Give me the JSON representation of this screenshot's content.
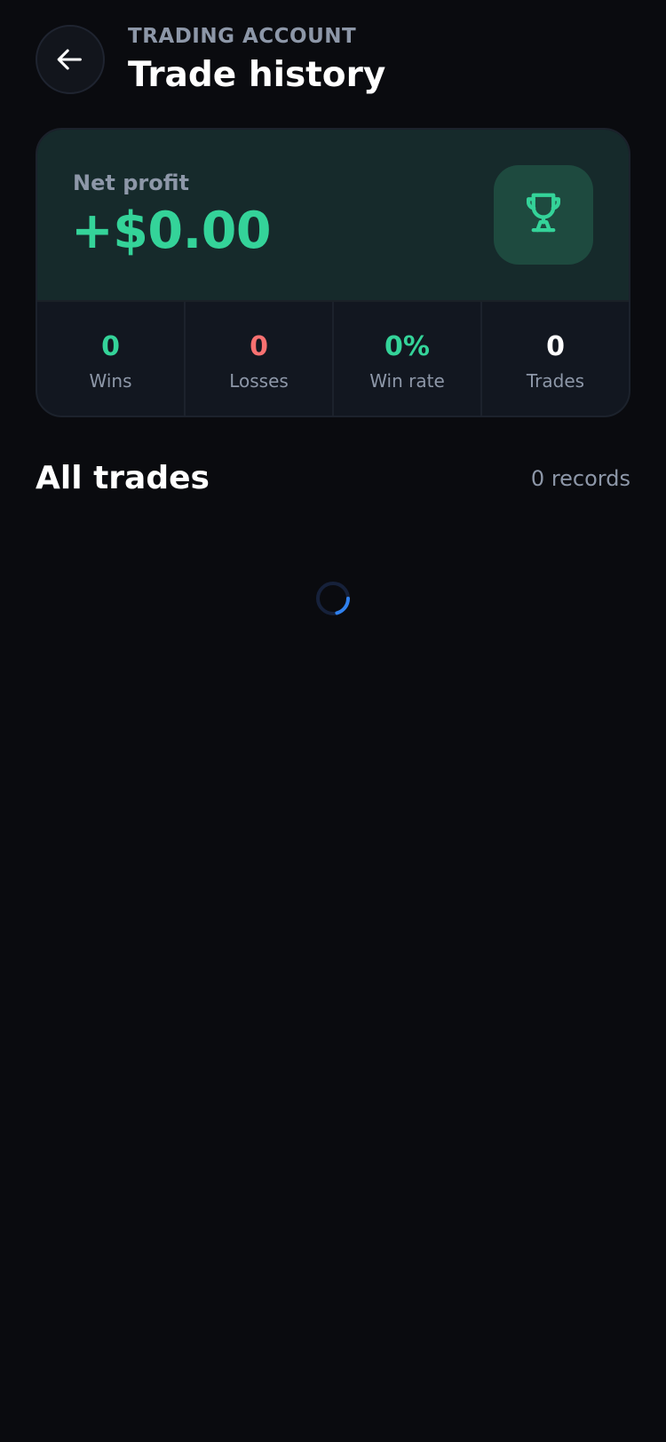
{
  "header": {
    "back_icon": "arrow-left-icon",
    "eyebrow": "TRADING ACCOUNT",
    "title": "Trade history"
  },
  "summary": {
    "net_profit_label": "Net profit",
    "net_profit_value": "+$0.00",
    "trophy_icon": "trophy-icon",
    "stats": [
      {
        "value": "0",
        "label": "Wins",
        "color": "#34d399"
      },
      {
        "value": "0",
        "label": "Losses",
        "color": "#f87171"
      },
      {
        "value": "0%",
        "label": "Win rate",
        "color": "#34d399"
      },
      {
        "value": "0",
        "label": "Trades",
        "color": "#ffffff"
      }
    ]
  },
  "trades": {
    "title": "All trades",
    "records": "0 records",
    "loading_icon": "loading-spinner-icon"
  },
  "colors": {
    "background": "#0a0b0f",
    "profit_green": "#34d399",
    "loss_red": "#f87171",
    "muted_text": "#8d97a8",
    "accent_blue": "#2f80ed"
  }
}
